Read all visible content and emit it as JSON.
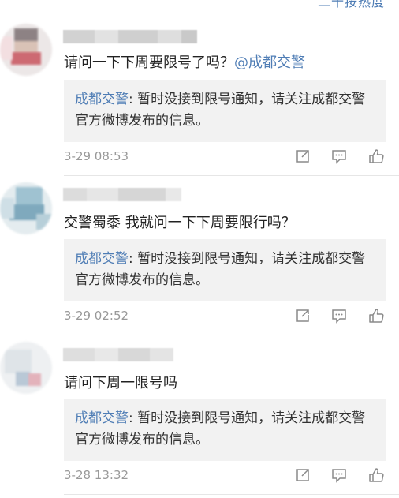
{
  "header": {
    "more_link": "二十按热度"
  },
  "comments": [
    {
      "text": "请问一下下周要限号了吗？",
      "mention": "@成都交警",
      "reply": {
        "author": "成都交警",
        "separator": ": ",
        "body": "暂时没接到限号通知，请关注成都交警官方微博发布的信息。"
      },
      "time": "3-29 08:53",
      "actions": {
        "share": "share-icon",
        "comment": "comment-icon",
        "like": "thumbs-up-icon"
      }
    },
    {
      "text": "交警蜀黍 我就问一下下周要限行吗？",
      "mention": "",
      "reply": {
        "author": "成都交警",
        "separator": ": ",
        "body": "暂时没接到限号通知，请关注成都交警官方微博发布的信息。"
      },
      "time": "3-29 02:52",
      "actions": {
        "share": "share-icon",
        "comment": "comment-icon",
        "like": "thumbs-up-icon"
      }
    },
    {
      "text": "请问下周一限号吗",
      "mention": "",
      "reply": {
        "author": "成都交警",
        "separator": ": ",
        "body": "暂时没接到限号通知，请关注成都交警官方微博发布的信息。"
      },
      "time": "3-28 13:32",
      "actions": {
        "share": "share-icon",
        "comment": "comment-icon",
        "like": "thumbs-up-icon"
      }
    }
  ],
  "colors": {
    "link": "#4f7db5",
    "reply_bg": "#f2f2f2",
    "meta_text": "#999999",
    "divider": "#e6e6e6"
  }
}
